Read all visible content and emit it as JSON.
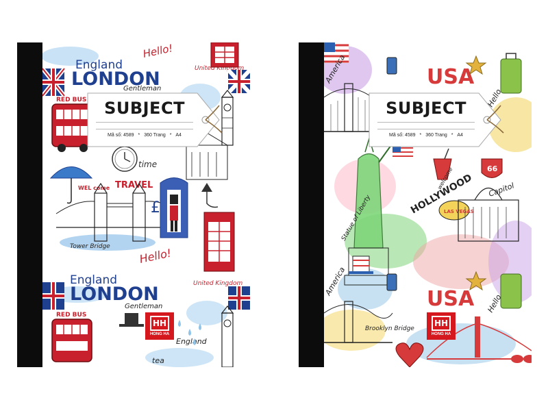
{
  "notebooks": [
    {
      "theme": "london",
      "label": {
        "title": "SUBJECT",
        "code": "Mã số: 4589",
        "pages": "360 Trang",
        "size": "A4",
        "separator": "*"
      },
      "brand": {
        "mark": "HH",
        "name": "HONG HA"
      },
      "doodles": {
        "england": "England",
        "london": "LONDON",
        "hello": "Hello!",
        "gentleman": "Gentleman",
        "united_kingdom": "United Kingdom",
        "red_bus": "RED BUS",
        "travel": "TRAVEL",
        "welcome": "WEL come",
        "tower_bridge": "Tower Bridge",
        "time": "time",
        "tea": "tea"
      },
      "colors": {
        "red": "#c8202c",
        "blue": "#1f3f8f",
        "water": "#8fc3e8"
      }
    },
    {
      "theme": "usa",
      "label": {
        "title": "SUBJECT",
        "code": "Mã số: 4589",
        "pages": "360 Trang",
        "size": "A4",
        "separator": "*"
      },
      "brand": {
        "mark": "HH",
        "name": "HONG HA"
      },
      "doodles": {
        "america": "America",
        "usa": "USA",
        "hello": "Hello",
        "brooklyn_bridge": "Brooklyn Bridge",
        "hollywood": "HOLLYWOOD",
        "welcome": "welcome",
        "las_vegas": "LAS VEGAS",
        "capitol": "Capitol",
        "route": "66",
        "liberty": "Statue of Liberty"
      },
      "colors": {
        "red": "#d63a3a",
        "blue": "#2b5fb0",
        "green": "#6cc36a",
        "purple": "#b58ad6",
        "yellow": "#f3d35a"
      }
    }
  ]
}
